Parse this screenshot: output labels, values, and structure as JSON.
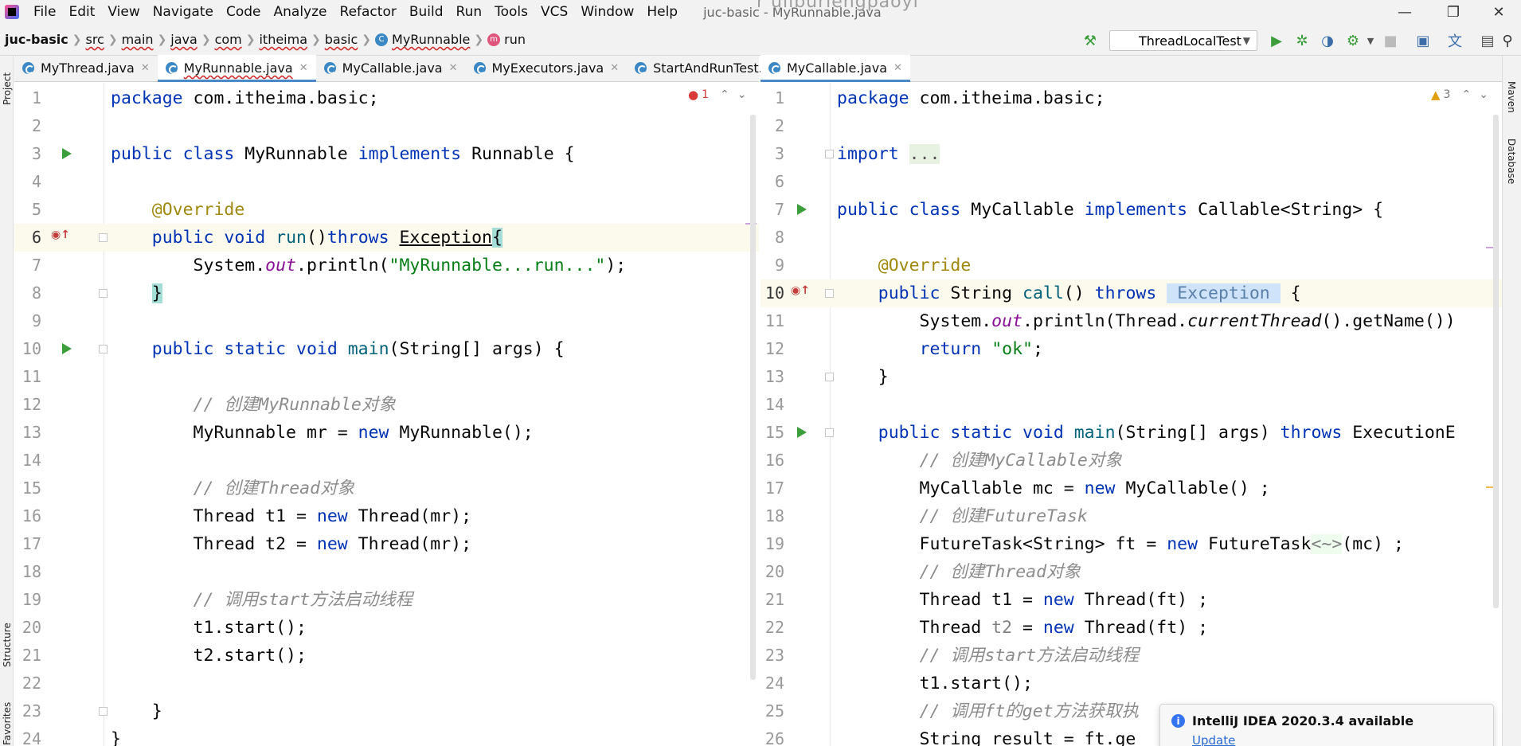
{
  "menu": {
    "items": [
      {
        "label": "File"
      },
      {
        "label": "Edit"
      },
      {
        "label": "View"
      },
      {
        "label": "Navigate"
      },
      {
        "label": "Code"
      },
      {
        "label": "Analyze"
      },
      {
        "label": "Refactor"
      },
      {
        "label": "Build"
      },
      {
        "label": "Run"
      },
      {
        "label": "Tools"
      },
      {
        "label": "VCS"
      },
      {
        "label": "Window"
      },
      {
        "label": "Help"
      }
    ],
    "window_title": "juc-basic - MyRunnable.java",
    "overlay_text": "r ullburiengpaoyi"
  },
  "breadcrumb": {
    "project": "juc-basic",
    "items": [
      "src",
      "main",
      "java",
      "com",
      "itheima",
      "basic",
      "MyRunnable",
      "run"
    ]
  },
  "toolbar": {
    "run_config": "ThreadLocalTest"
  },
  "left_tabs": [
    {
      "label": "MyThread.java"
    },
    {
      "label": "MyRunnable.java"
    },
    {
      "label": "MyCallable.java"
    },
    {
      "label": "MyExecutors.java"
    },
    {
      "label": "StartAndRunTest.ja∨"
    }
  ],
  "right_tabs": [
    {
      "label": "MyCallable.java"
    }
  ],
  "side_strips": {
    "project": "Project",
    "structure": "Structure",
    "favorites": "Favorites",
    "maven": "Maven",
    "database": "Database"
  },
  "left_editor": {
    "inspection_count": "1",
    "line_numbers": [
      "1",
      "2",
      "3",
      "4",
      "5",
      "6",
      "7",
      "8",
      "9",
      "10",
      "11",
      "12",
      "13",
      "14",
      "15",
      "16",
      "17",
      "18",
      "19",
      "20",
      "21",
      "22",
      "23",
      "24"
    ]
  },
  "right_editor": {
    "inspection_count": "3",
    "line_numbers": [
      "1",
      "2",
      "3",
      "6",
      "7",
      "8",
      "9",
      "10",
      "11",
      "12",
      "13",
      "14",
      "15",
      "16",
      "17",
      "18",
      "19",
      "20",
      "21",
      "22",
      "23",
      "24",
      "25",
      "26"
    ]
  },
  "notification": {
    "title": "IntelliJ IDEA 2020.3.4 available",
    "link": "Update"
  },
  "colors": {
    "keyword": "#0033b3",
    "annotation": "#9e880d",
    "string": "#067d17",
    "comment": "#8c8c8c",
    "static_field": "#871094",
    "method_decl": "#00627a",
    "tab_underline": "#4a88c7"
  }
}
